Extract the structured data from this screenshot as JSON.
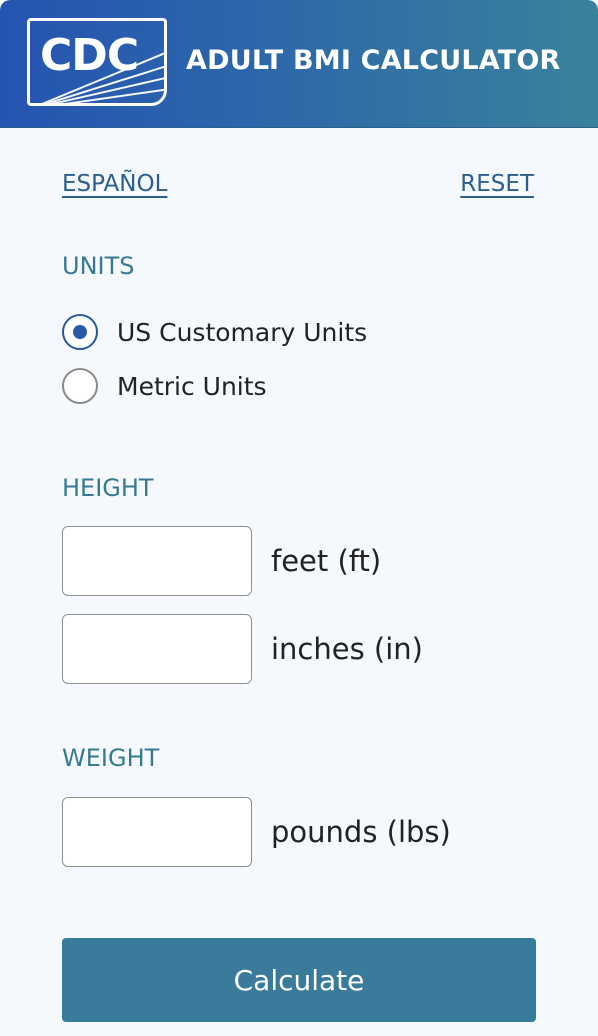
{
  "header": {
    "logo_text": "CDC",
    "title": "ADULT BMI CALCULATOR"
  },
  "links": {
    "espanol": "ESPAÑOL",
    "reset": "RESET"
  },
  "units": {
    "title": "UNITS",
    "options": [
      {
        "label": "US Customary Units",
        "selected": true
      },
      {
        "label": "Metric Units",
        "selected": false
      }
    ]
  },
  "height": {
    "title": "HEIGHT",
    "feet": {
      "value": "",
      "unit_label": "feet (ft)"
    },
    "inches": {
      "value": "",
      "unit_label": "inches (in)"
    }
  },
  "weight": {
    "title": "WEIGHT",
    "pounds": {
      "value": "",
      "unit_label": "pounds (lbs)"
    }
  },
  "calculate_label": "Calculate",
  "colors": {
    "header_gradient_start": "#2554b2",
    "header_gradient_end": "#39829b",
    "section_title": "#367a92",
    "link": "#2b5d8e",
    "radio_selected": "#2958a8",
    "button": "#3a7a9a",
    "panel_background": "#f5f9fe"
  }
}
